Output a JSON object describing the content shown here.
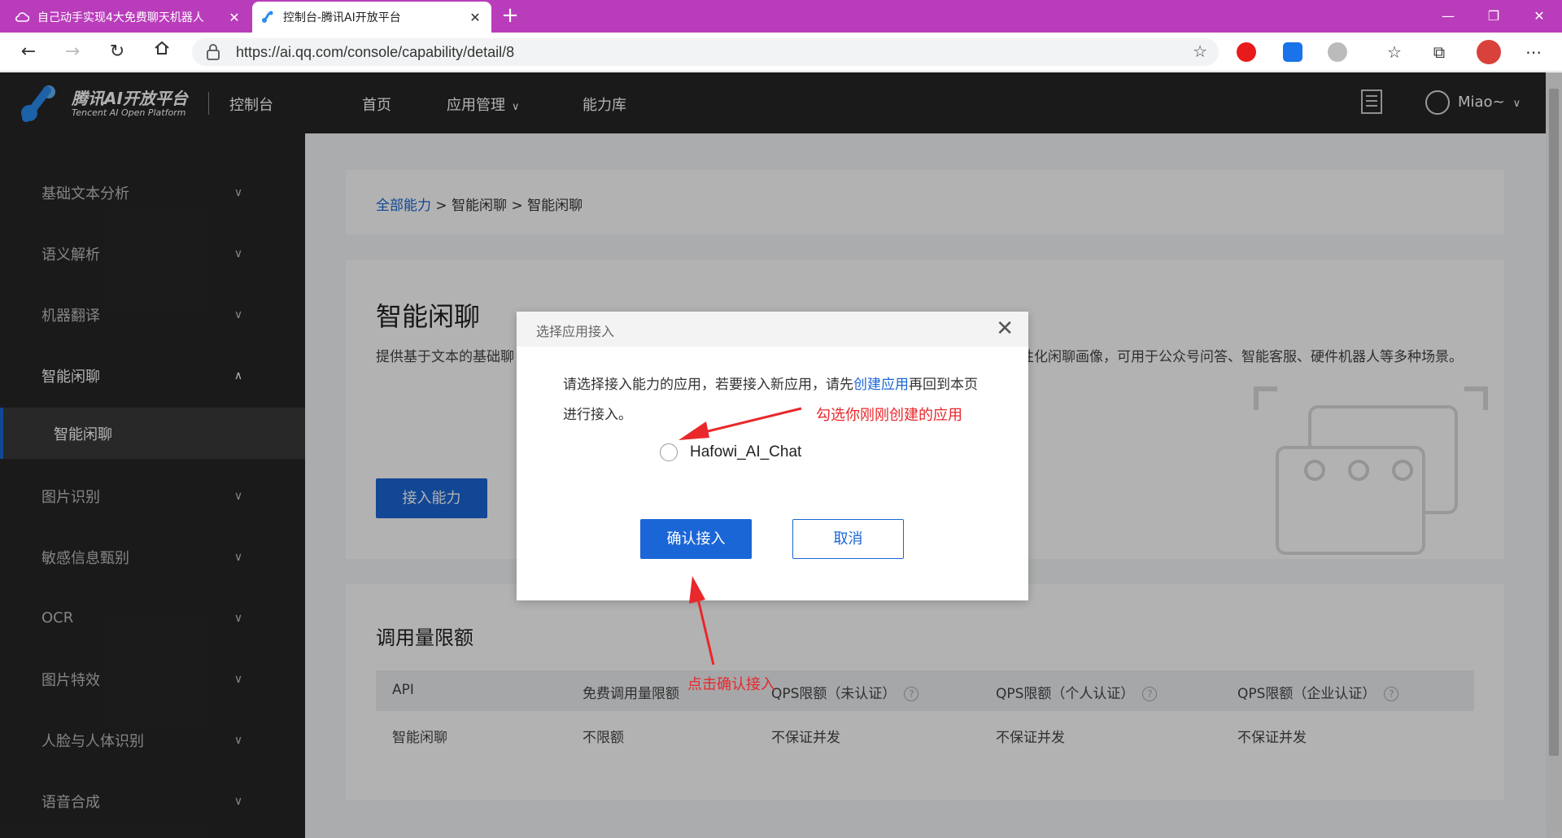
{
  "browser": {
    "tabs": [
      {
        "title": "自己动手实现4大免费聊天机器人",
        "active": false
      },
      {
        "title": "控制台-腾讯AI开放平台",
        "active": true
      }
    ],
    "url": "https://ai.qq.com/console/capability/detail/8"
  },
  "site": {
    "brand": "腾讯AI开放平台",
    "brand_sub": "Tencent AI Open Platform",
    "console_label": "控制台",
    "nav": [
      "首页",
      "应用管理",
      "能力库"
    ],
    "user": "Miao~"
  },
  "sidebar": {
    "items": [
      {
        "label": "基础文本分析",
        "expanded": false
      },
      {
        "label": "语义解析",
        "expanded": false
      },
      {
        "label": "机器翻译",
        "expanded": false
      },
      {
        "label": "智能闲聊",
        "expanded": true
      },
      {
        "label": "图片识别",
        "expanded": false
      },
      {
        "label": "敏感信息甄别",
        "expanded": false
      },
      {
        "label": "OCR",
        "expanded": false
      },
      {
        "label": "图片特效",
        "expanded": false
      },
      {
        "label": "人脸与人体识别",
        "expanded": false
      },
      {
        "label": "语音合成",
        "expanded": false
      }
    ],
    "active_sub": "智能闲聊"
  },
  "breadcrumb": {
    "root": "全部能力",
    "sep1": ">",
    "level1": "智能闲聊",
    "sep2": ">",
    "level2": "智能闲聊"
  },
  "capability": {
    "title": "智能闲聊",
    "description_start": "提供基于文本的基础聊",
    "description_end": "性化闲聊画像，可用于公众号问答、智能客服、硬件机器人等多种场景。",
    "access_button": "接入能力"
  },
  "quota": {
    "title": "调用量限额",
    "columns": [
      "API",
      "免费调用量限额",
      "QPS限额（未认证）",
      "QPS限额（个人认证）",
      "QPS限额（企业认证）"
    ],
    "rows": [
      [
        "智能闲聊",
        "不限额",
        "不保证并发",
        "不保证并发",
        "不保证并发"
      ]
    ]
  },
  "modal": {
    "title": "选择应用接入",
    "close_glyph": "✕",
    "text_before_link": "请选择接入能力的应用，若要接入新应用，请先",
    "link": "创建应用",
    "text_after_link": "再回到本页进行接入。",
    "option": "Hafowi_AI_Chat",
    "confirm": "确认接入",
    "cancel": "取消"
  },
  "annotations": {
    "select_hint": "勾选你刚刚创建的应用",
    "confirm_hint": "点击确认接入"
  },
  "colors": {
    "tabbar": "#b93dbb",
    "header": "#262626",
    "primary": "#1b66d6",
    "annotation": "#e8282b"
  }
}
